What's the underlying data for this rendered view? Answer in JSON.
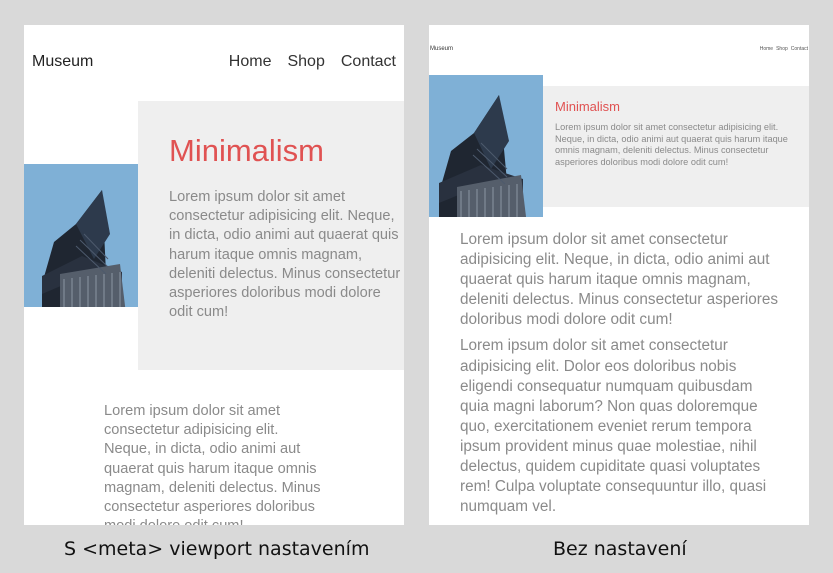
{
  "left_panel": {
    "logo": "Museum",
    "nav": [
      "Home",
      "Shop",
      "Contact"
    ],
    "title": "Minimalism",
    "hero_text": "Lorem ipsum dolor sit amet consectetur adipisicing elit. Neque, in dicta, odio animi aut quaerat quis harum itaque omnis magnam, deleniti delectus. Minus consectetur asperiores doloribus modi dolore odit cum!",
    "body_text": "Lorem ipsum dolor sit amet consectetur adipisicing elit. Neque, in dicta, odio animi aut quaerat quis harum itaque omnis magnam, deleniti delectus. Minus consectetur asperiores doloribus modi dolore odit cum!",
    "caption": "S <meta> viewport nastavením"
  },
  "right_panel": {
    "logo": "Museum",
    "nav": [
      "Home",
      "Shop",
      "Contact"
    ],
    "title": "Minimalism",
    "hero_text": "Lorem ipsum dolor sit amet consectetur adipisicing elit. Neque, in dicta, odio animi aut quaerat quis harum itaque omnis magnam, deleniti delectus. Minus consectetur asperiores doloribus modi dolore odit cum!",
    "body_paragraphs": [
      "Lorem ipsum dolor sit amet consectetur adipisicing elit. Neque, in dicta, odio animi aut quaerat quis harum itaque omnis magnam, deleniti delectus. Minus consectetur asperiores doloribus modi dolore odit cum!",
      "Lorem ipsum dolor sit amet consectetur adipisicing elit. Dolor eos doloribus nobis eligendi consequatur numquam quibusdam quia magni laborum? Non quas doloremque quo, exercitationem eveniet rerum tempora ipsum provident minus quae molestiae, nihil delectus, quidem cupiditate quasi voluptates rem! Culpa voluptate consequuntur illo, quasi numquam vel."
    ],
    "caption": "Bez nastavení"
  },
  "colors": {
    "background": "#d9d9d9",
    "panel": "#ffffff",
    "accent": "#e05252",
    "text_gray": "#8a8a8a",
    "hero_box": "#efefef",
    "sky": "#7fb0d6"
  },
  "icons": {
    "hero_image": "modern-building-photo"
  }
}
